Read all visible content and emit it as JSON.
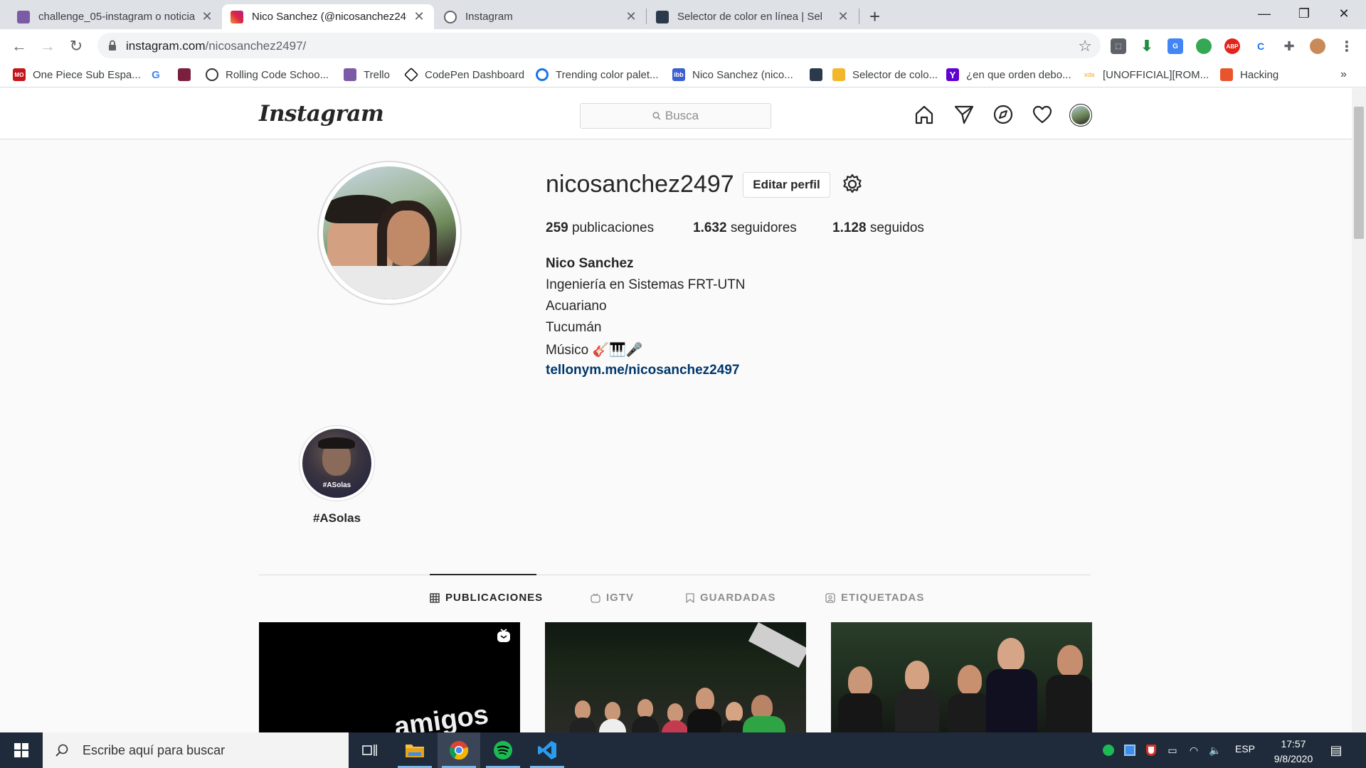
{
  "browser": {
    "tabs": [
      {
        "title": "challenge_05-instagram o noticia",
        "favicon_color": "#7b5aa6"
      },
      {
        "title": "Nico Sanchez (@nicosanchez249",
        "favicon_color": "#d6249f"
      },
      {
        "title": "Instagram",
        "favicon_color": "#5f6368"
      },
      {
        "title": "Selector de color en línea | Sel",
        "favicon_color": "#2b3a4a"
      }
    ],
    "url_host": "instagram.com",
    "url_path": "/nicosanchez2497/",
    "bookmarks": [
      {
        "label": "One Piece Sub Espa...",
        "icon_color": "#c4161c",
        "icon_text": "MO"
      },
      {
        "label": "",
        "icon_color": "#4285f4",
        "icon_text": "G"
      },
      {
        "label": "",
        "icon_color": "#7a1f3d",
        "icon_text": ""
      },
      {
        "label": "Rolling Code Schoo...",
        "icon_color": "#333333",
        "icon_text": ""
      },
      {
        "label": "Trello",
        "icon_color": "#7b5aa6",
        "icon_text": ""
      },
      {
        "label": "CodePen Dashboard",
        "icon_color": "#111111",
        "icon_text": ""
      },
      {
        "label": "Trending color palet...",
        "icon_color": "#1a73e8",
        "icon_text": ""
      },
      {
        "label": "Nico Sanchez (nico...",
        "icon_color": "#3b5fd0",
        "icon_text": "ibb"
      },
      {
        "label": "",
        "icon_color": "#2b3a4a",
        "icon_text": ""
      },
      {
        "label": "Selector de colo...",
        "icon_color": "#f2b72b",
        "icon_text": ""
      },
      {
        "label": "¿en que orden debo...",
        "icon_color": "#6001d2",
        "icon_text": "Y"
      },
      {
        "label": "[UNOFFICIAL][ROM...",
        "icon_color": "#f5a623",
        "icon_text": "xda"
      },
      {
        "label": "Hacking",
        "icon_color": "#e8542c",
        "icon_text": ""
      }
    ],
    "bookmarks_overflow": "»"
  },
  "instagram": {
    "logo": "Instagram",
    "search_placeholder": "Busca",
    "username": "nicosanchez2497",
    "edit_profile": "Editar perfil",
    "stats": [
      {
        "value": "259",
        "label": "publicaciones"
      },
      {
        "value": "1.632",
        "label": "seguidores"
      },
      {
        "value": "1.128",
        "label": "seguidos"
      }
    ],
    "bio": {
      "name": "Nico Sanchez",
      "lines": [
        "Ingeniería en Sistemas FRT-UTN",
        "Acuariano",
        "Tucumán",
        "Músico 🎸🎹🎤"
      ],
      "link": "tellonym.me/nicosanchez2497"
    },
    "highlight": {
      "label": "#ASolas",
      "cover_text": "#ASolas"
    },
    "tabs": [
      "PUBLICACIONES",
      "IGTV",
      "GUARDADAS",
      "ETIQUETADAS"
    ],
    "active_tab": "PUBLICACIONES",
    "post_1_text": "amigos"
  },
  "taskbar": {
    "search_placeholder": "Escribe aquí para buscar",
    "language": "ESP",
    "time": "17:57",
    "date": "9/8/2020"
  }
}
